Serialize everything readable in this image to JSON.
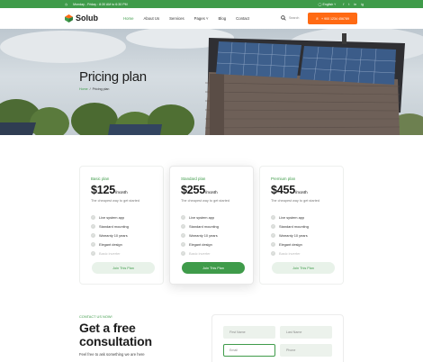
{
  "topbar": {
    "hours": "Monday - Friday : 8:30 AM to 6:30 PM",
    "language": "English",
    "social": [
      "f",
      "t",
      "in",
      "ig"
    ]
  },
  "header": {
    "brand": "Solub",
    "nav": [
      "Home",
      "About Us",
      "Services",
      "Pages",
      "Blog",
      "Contact"
    ],
    "search_label": "Search",
    "phone_button": "+ 900 1234 456789",
    "accent": "#3f9b4a",
    "button_color": "#ff6a13"
  },
  "hero": {
    "title": "Pricing plan",
    "crumb_home": "Home",
    "crumb_sep": "/",
    "crumb_current": "Pricing plan"
  },
  "plans": [
    {
      "name": "Basic plan",
      "price": "$125",
      "per": "/month",
      "tagline": "The cheapest way to get started",
      "features": [
        "Live system app",
        "Standard mounting",
        "Warranty 10 years",
        "Elegant design",
        "Basic inverter"
      ],
      "button": "Join This Plan"
    },
    {
      "name": "Standard plan",
      "price": "$255",
      "per": "/month",
      "tagline": "The cheapest way to get started",
      "features": [
        "Live system app",
        "Standard mounting",
        "Warranty 10 years",
        "Elegant design",
        "Basic inverter"
      ],
      "button": "Join This Plan"
    },
    {
      "name": "Premium plan",
      "price": "$455",
      "per": "/month",
      "tagline": "The cheapest way to get started",
      "features": [
        "Live system app",
        "Standard mounting",
        "Warranty 10 years",
        "Elegant design",
        "Basic inverter"
      ],
      "button": "Join This Plan"
    }
  ],
  "consult": {
    "tag": "CONTACT US NOW!",
    "title": "Get a free consultation",
    "sub": "Feel free to ask something we are here",
    "first_name": "First Name",
    "last_name": "Last Name",
    "email": "Email",
    "phone": "Phone"
  }
}
